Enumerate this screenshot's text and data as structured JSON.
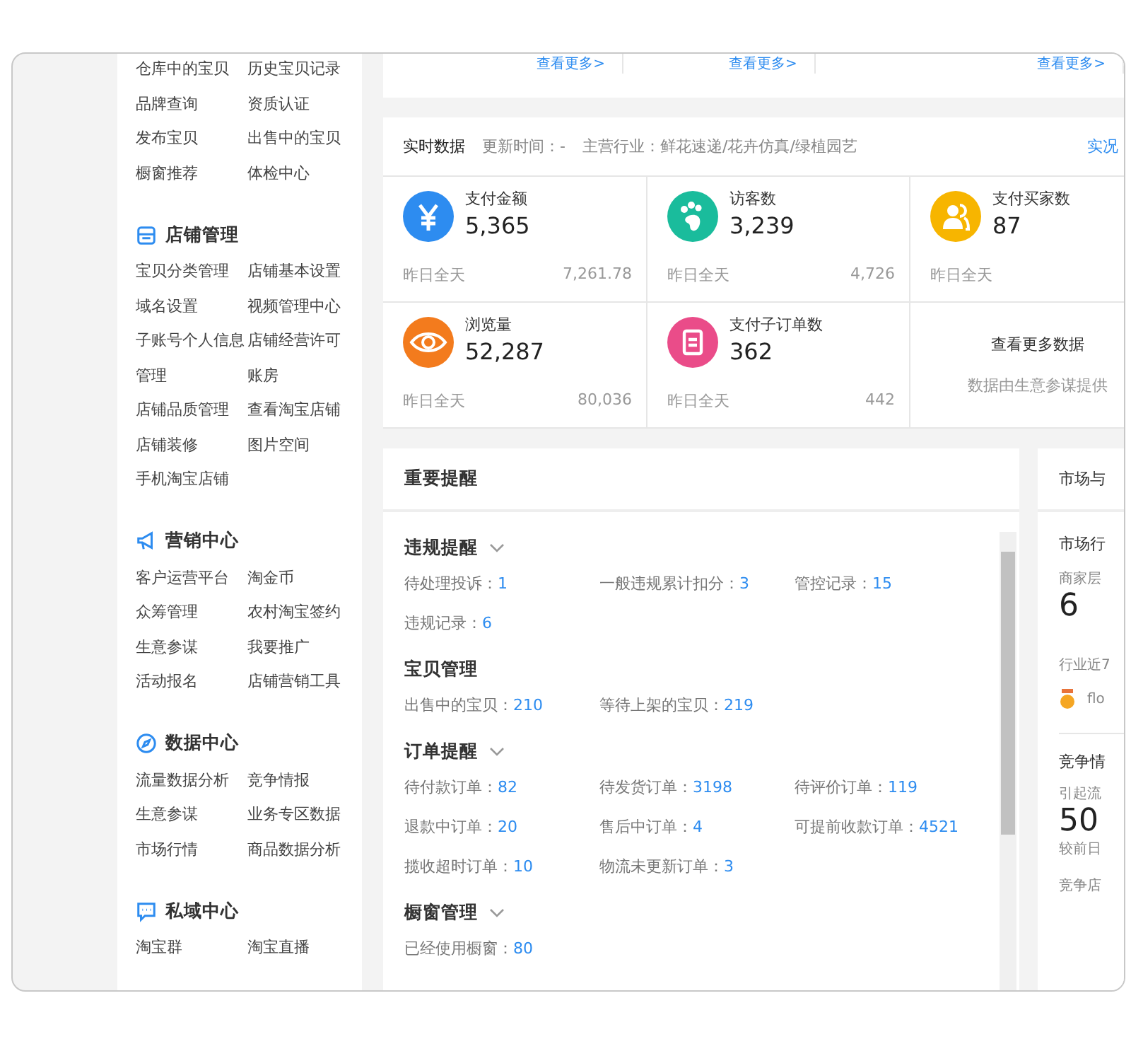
{
  "sidebar": {
    "sections": [
      {
        "items": [
          "仓库中的宝贝",
          "历史宝贝记录",
          "品牌查询",
          "资质认证",
          "发布宝贝",
          "出售中的宝贝",
          "橱窗推荐",
          "体检中心"
        ]
      },
      {
        "title": "店铺管理",
        "items": [
          "宝贝分类管理",
          "店铺基本设置",
          "域名设置",
          "视频管理中心",
          "子账号个人信息管理",
          "店铺经营许可账房",
          "店铺品质管理",
          "查看淘宝店铺",
          "店铺装修",
          "图片空间",
          "手机淘宝店铺"
        ]
      },
      {
        "title": "营销中心",
        "items": [
          "客户运营平台",
          "淘金币",
          "众筹管理",
          "农村淘宝签约",
          "生意参谋",
          "我要推广",
          "活动报名",
          "店铺营销工具"
        ]
      },
      {
        "title": "数据中心",
        "items": [
          "流量数据分析",
          "竞争情报",
          "生意参谋",
          "业务专区数据",
          "市场行情",
          "商品数据分析"
        ]
      },
      {
        "title": "私域中心",
        "items": [
          "淘宝群",
          "淘宝直播"
        ]
      }
    ]
  },
  "top_links": [
    "查看更多>",
    "查看更多>",
    "查看更多>"
  ],
  "realtime": {
    "title": "实时数据",
    "update": "更新时间：-",
    "industry": "主营行业：鲜花速递/花卉仿真/绿植园艺",
    "link": "实况",
    "stats": [
      {
        "color": "#2d8cf0",
        "label": "支付金额",
        "value": "5,365",
        "footer": "昨日全天",
        "previous": "7,261.78"
      },
      {
        "color": "#1abc9c",
        "label": "访客数",
        "value": "3,239",
        "footer": "昨日全天",
        "previous": "4,726"
      },
      {
        "color": "#f7b500",
        "label": "支付买家数",
        "value": "87",
        "footer": "昨日全天"
      },
      {
        "color": "#f37b1d",
        "label": "浏览量",
        "value": "52,287",
        "footer": "昨日全天",
        "previous": "80,036"
      },
      {
        "color": "#ea4c89",
        "label": "支付子订单数",
        "value": "362",
        "footer": "昨日全天",
        "previous": "442"
      }
    ],
    "more": "查看更多数据",
    "source": "数据由生意参谋提供"
  },
  "reminders": {
    "title": "重要提醒",
    "groups": [
      {
        "title": "违规提醒",
        "collapsible": true,
        "items": [
          {
            "label": "待处理投诉：",
            "value": "1"
          },
          {
            "label": "一般违规累计扣分：",
            "value": "3"
          },
          {
            "label": "管控记录：",
            "value": "15"
          },
          {
            "label": "违规记录：",
            "value": "6"
          }
        ]
      },
      {
        "title": "宝贝管理",
        "collapsible": false,
        "items": [
          {
            "label": "出售中的宝贝：",
            "value": "210"
          },
          {
            "label": "等待上架的宝贝：",
            "value": "219"
          }
        ]
      },
      {
        "title": "订单提醒",
        "collapsible": true,
        "items": [
          {
            "label": "待付款订单：",
            "value": "82"
          },
          {
            "label": "待发货订单：",
            "value": "3198"
          },
          {
            "label": "待评价订单：",
            "value": "119"
          },
          {
            "label": "退款中订单：",
            "value": "20"
          },
          {
            "label": "售后中订单：",
            "value": "4"
          },
          {
            "label": "可提前收款订单：",
            "value": "4521"
          },
          {
            "label": "揽收超时订单：",
            "value": "10"
          },
          {
            "label": "物流未更新订单：",
            "value": "3"
          }
        ]
      },
      {
        "title": "橱窗管理",
        "collapsible": true,
        "items": [
          {
            "label": "已经使用橱窗：",
            "value": "80"
          }
        ]
      }
    ]
  },
  "market": {
    "title": "市场与",
    "section1": "市场行",
    "level_label": "商家层",
    "level_value": "6",
    "industry_label": "行业近7",
    "rank_text": "flo",
    "section2": "竞争情",
    "loss_label": "引起流",
    "loss_value": "50",
    "compare": "较前日",
    "shops_label": "竞争店"
  }
}
